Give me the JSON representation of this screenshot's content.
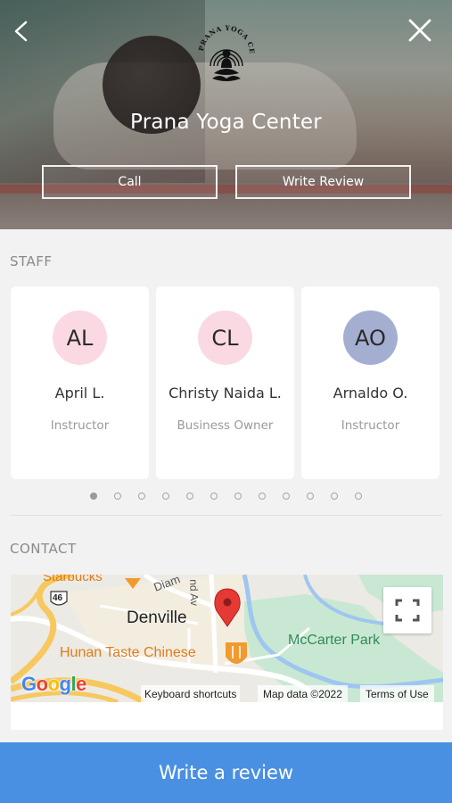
{
  "header": {
    "title": "Prana Yoga Center",
    "logo_text": "PRANA YOGA CENTER",
    "call_label": "Call",
    "write_review_label": "Write Review"
  },
  "staff": {
    "section_label": "STAFF",
    "members": [
      {
        "initials": "AL",
        "name": "April L.",
        "role": "Instructor",
        "avatar_color": "#fbd9e3"
      },
      {
        "initials": "CL",
        "name": "Christy Naida L.",
        "role": "Business Owner",
        "avatar_color": "#fbd9e3"
      },
      {
        "initials": "AO",
        "name": "Arnaldo O.",
        "role": "Instructor",
        "avatar_color": "#a4aed1"
      }
    ],
    "pagination": {
      "total": 12,
      "active": 1
    }
  },
  "contact": {
    "section_label": "CONTACT",
    "map": {
      "labels": {
        "starbucks": "Starbucks",
        "route": "46",
        "town": "Denville",
        "restaurant": "Hunan Taste Chinese",
        "park": "McCarter Park",
        "road1": "Diam",
        "road2": "nd Av"
      },
      "google_logo": "Google",
      "keyboard_shortcuts": "Keyboard shortcuts",
      "map_data": "Map data ©2022",
      "terms": "Terms of Use"
    }
  },
  "footer": {
    "cta_label": "Write a review"
  },
  "colors": {
    "accent": "#4a90e2",
    "pin": "#e53935",
    "park": "#c9e8d3",
    "highway": "#f6c85f",
    "restaurant_icon": "#f29a2e"
  }
}
